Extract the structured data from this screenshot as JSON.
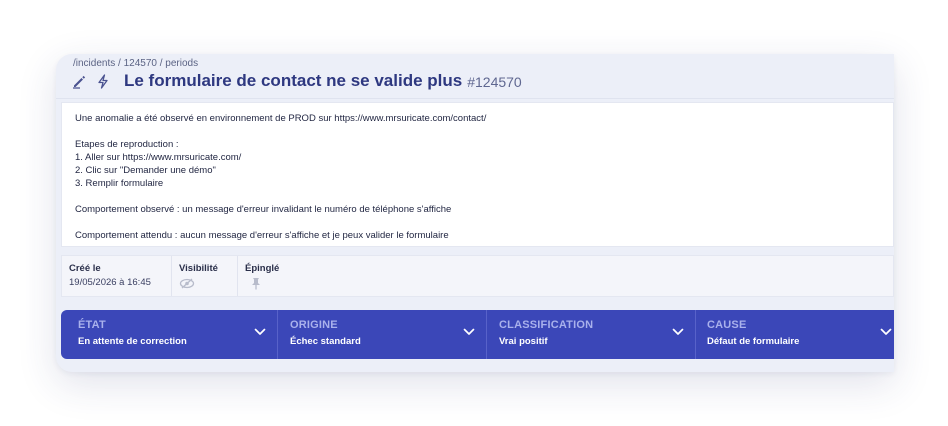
{
  "breadcrumb": "/incidents / 124570 / periods",
  "header": {
    "title": "Le formulaire de contact ne se valide plus",
    "ticket": "#124570",
    "edit_icon": "pencil-icon",
    "action_icon": "lightning-icon"
  },
  "description": {
    "lines": [
      "Une anomalie a été observé en environnement de PROD sur https://www.mrsuricate.com/contact/",
      "",
      "Etapes de reproduction :",
      "1. Aller sur https://www.mrsuricate.com/",
      "2. Clic sur \"Demander une démo\"",
      "3. Remplir formulaire",
      "",
      "Comportement observé : un message d'erreur invalidant le numéro de téléphone s'affiche",
      "",
      "Comportement attendu : aucun message d'erreur s'affiche et je peux valider le formulaire"
    ]
  },
  "meta": {
    "created_label": "Créé le",
    "created_value": "19/05/2026 à 16:45",
    "visibility_label": "Visibilité",
    "visibility_icon": "eye-slash-icon",
    "pinned_label": "Épinglé",
    "pinned_icon": "pin-icon"
  },
  "status": {
    "state_label": "ÉTAT",
    "state_value": "En attente de correction",
    "origin_label": "ORIGINE",
    "origin_value": "Échec standard",
    "classification_label": "CLASSIFICATION",
    "classification_value": "Vrai positif",
    "cause_label": "CAUSE",
    "cause_value": "Défaut de formulaire"
  },
  "colors": {
    "title": "#2e3880",
    "status_bar": "#3b47b8",
    "status_label": "#a9b1ec"
  }
}
